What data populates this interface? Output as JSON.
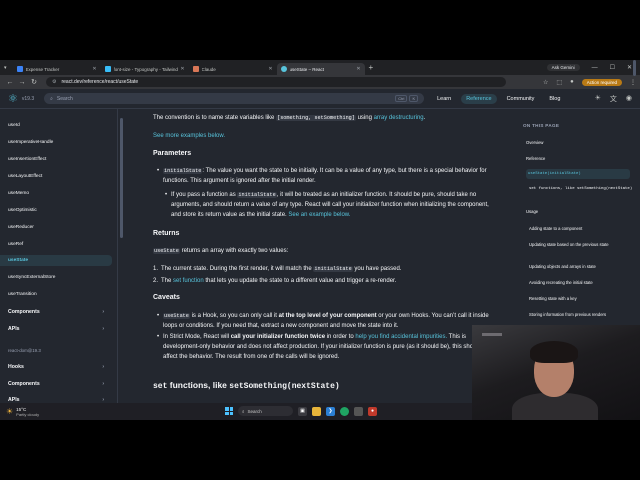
{
  "browser": {
    "tabs": [
      {
        "label": "Expense Tracker",
        "color": "#3b82f6",
        "active": false
      },
      {
        "label": "font-size - Typography - Tailwind",
        "color": "#38bdf8",
        "active": false
      },
      {
        "label": "Claude",
        "color": "#d97757",
        "active": false
      },
      {
        "label": "useState – React",
        "color": "#58c4dc",
        "active": true
      }
    ],
    "profile_label": "Ask Gemini",
    "url": "react.dev/reference/react/useState",
    "action_required": "Action required"
  },
  "site": {
    "version": "v19.3",
    "search_placeholder": "Search",
    "search_keys": [
      "Ctrl",
      "K"
    ],
    "nav": [
      {
        "label": "Learn",
        "active": false
      },
      {
        "label": "Reference",
        "active": true
      },
      {
        "label": "Community",
        "active": false
      },
      {
        "label": "Blog",
        "active": false
      }
    ]
  },
  "sidebar": {
    "items": [
      {
        "label": "useId",
        "kind": "item"
      },
      {
        "label": "useImperativeHandle",
        "kind": "item"
      },
      {
        "label": "useInsertionEffect",
        "kind": "item"
      },
      {
        "label": "useLayoutEffect",
        "kind": "item"
      },
      {
        "label": "useMemo",
        "kind": "item"
      },
      {
        "label": "useOptimistic",
        "kind": "item"
      },
      {
        "label": "useReducer",
        "kind": "item"
      },
      {
        "label": "useRef",
        "kind": "item"
      },
      {
        "label": "useState",
        "kind": "active"
      },
      {
        "label": "useSyncExternalStore",
        "kind": "item"
      },
      {
        "label": "useTransition",
        "kind": "item"
      },
      {
        "label": "Components",
        "kind": "section"
      },
      {
        "label": "APIs",
        "kind": "section"
      },
      {
        "label": "react-dom@19.3",
        "kind": "muted"
      },
      {
        "label": "Hooks",
        "kind": "section"
      },
      {
        "label": "Components",
        "kind": "section"
      },
      {
        "label": "APIs",
        "kind": "section"
      }
    ]
  },
  "content": {
    "convention": {
      "t1": "The convention is to name state variables like ",
      "c1": "[something, setSomething]",
      "t2": " using ",
      "link": "array destructuring",
      "t3": "."
    },
    "see_more": "See more examples below.",
    "parameters_heading": "Parameters",
    "param1": {
      "code": "initialState",
      "text": ": The value you want the state to be initially. It can be a value of any type, but there is a special behavior for functions. This argument is ignored after the initial render."
    },
    "param2": {
      "t1": "If you pass a function as ",
      "code": "initialState",
      "t2": ", it will be treated as an initializer function. It should be pure, should take no arguments, and should return a value of any type. React will call your initializer function when initializing the component, and store its return value as the initial state. ",
      "link": "See an example below."
    },
    "returns_heading": "Returns",
    "returns_intro": {
      "code": "useState",
      "text": " returns an array with exactly two values:"
    },
    "ret1": {
      "t1": "The current state. During the first render, it will match the ",
      "code": "initialState",
      "t2": " you have passed."
    },
    "ret2": {
      "t1": "The ",
      "link": "set function",
      "t2": " that lets you update the state to a different value and trigger a re-render."
    },
    "caveats_heading": "Caveats",
    "cav1": {
      "code": "useState",
      "t1": " is a Hook, so you can only call it ",
      "bold": "at the top level of your component",
      "t2": " or your own Hooks. You can’t call it inside loops or conditions. If you need that, extract a new component and move the state into it."
    },
    "cav2": {
      "t1": "In Strict Mode, React will ",
      "bold": "call your initializer function twice",
      "t2": " in order to ",
      "link": "help you find accidental impurities.",
      "t3": " This is development-only behavior and does not affect production. If your initializer function is pure (as it should be), this should not affect the behavior. The result from one of the calls will be ignored."
    },
    "set_heading": {
      "code1": "set",
      "t1": " functions, like ",
      "code2": "setSomething(nextState)"
    }
  },
  "toc": {
    "title": "ON THIS PAGE",
    "items": [
      {
        "label": "Overview",
        "kind": "item"
      },
      {
        "label": "Reference",
        "kind": "item"
      },
      {
        "label": "useState(initialState)",
        "kind": "active"
      },
      {
        "label": "set functions, like setSomething(nextState)",
        "kind": "sub"
      },
      {
        "label": "Usage",
        "kind": "item"
      },
      {
        "label": "Adding state to a component",
        "kind": "sub"
      },
      {
        "label": "Updating state based on the previous state",
        "kind": "sub"
      },
      {
        "label": "Updating objects and arrays in state",
        "kind": "sub"
      },
      {
        "label": "Avoiding recreating the initial state",
        "kind": "sub"
      },
      {
        "label": "Resetting state with a key",
        "kind": "sub"
      },
      {
        "label": "Storing information from previous renders",
        "kind": "sub"
      }
    ]
  },
  "taskbar": {
    "weather_temp": "15°C",
    "weather_desc": "Partly cloudy",
    "search_label": "Search"
  }
}
